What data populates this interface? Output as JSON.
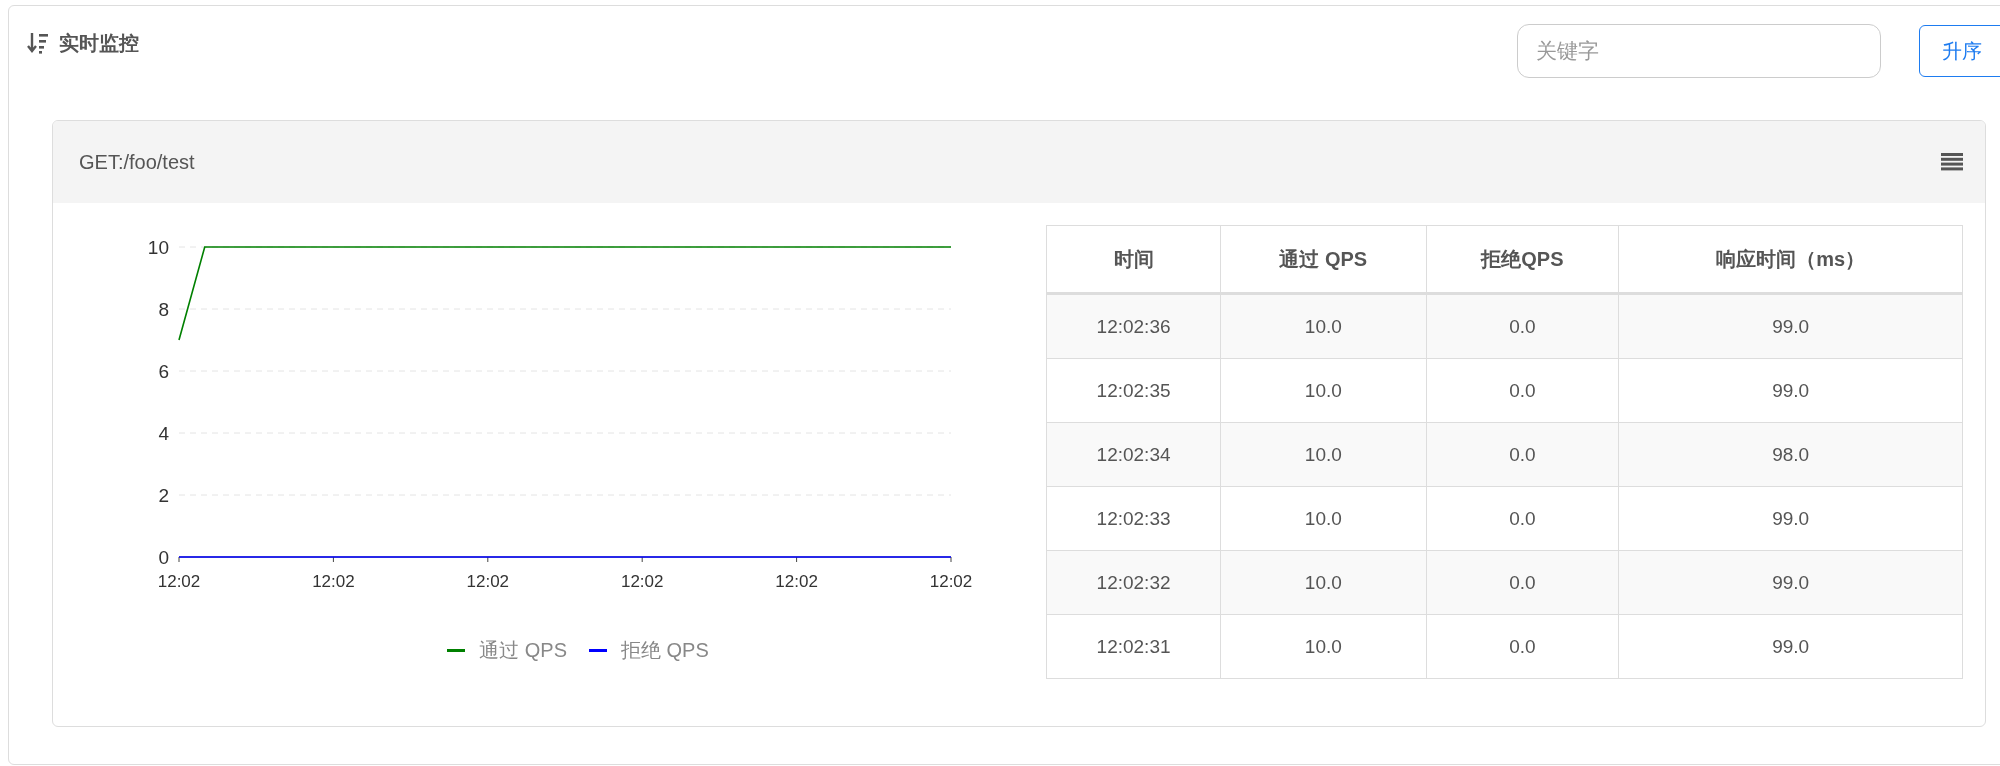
{
  "panel": {
    "title": "实时监控",
    "search": {
      "placeholder": "关键字"
    },
    "sort_button": "升序"
  },
  "card": {
    "title": "GET:/foo/test",
    "chart_data": {
      "type": "line",
      "categories": [
        "12:02",
        null,
        null,
        null,
        null,
        null,
        "12:02",
        null,
        null,
        null,
        null,
        null,
        "12:02",
        null,
        null,
        null,
        null,
        null,
        "12:02",
        null,
        null,
        null,
        null,
        null,
        "12:02",
        null,
        null,
        null,
        null,
        null,
        "12:02"
      ],
      "grid": true,
      "ylim": [
        0,
        10
      ],
      "yticks": [
        0,
        2,
        4,
        6,
        8,
        10
      ],
      "series": [
        {
          "name": "通过 QPS",
          "color": "#008000",
          "values": [
            7,
            10,
            10,
            10,
            10,
            10,
            10,
            10,
            10,
            10,
            10,
            10,
            10,
            10,
            10,
            10,
            10,
            10,
            10,
            10,
            10,
            10,
            10,
            10,
            10,
            10,
            10,
            10,
            10,
            10,
            10
          ]
        },
        {
          "name": "拒绝 QPS",
          "color": "#0000ff",
          "values": [
            0,
            0,
            0,
            0,
            0,
            0,
            0,
            0,
            0,
            0,
            0,
            0,
            0,
            0,
            0,
            0,
            0,
            0,
            0,
            0,
            0,
            0,
            0,
            0,
            0,
            0,
            0,
            0,
            0,
            0,
            0
          ]
        }
      ]
    },
    "table": {
      "columns": [
        "时间",
        "通过 QPS",
        "拒绝QPS",
        "响应时间（ms）"
      ],
      "rows": [
        [
          "12:02:36",
          "10.0",
          "0.0",
          "99.0"
        ],
        [
          "12:02:35",
          "10.0",
          "0.0",
          "99.0"
        ],
        [
          "12:02:34",
          "10.0",
          "0.0",
          "98.0"
        ],
        [
          "12:02:33",
          "10.0",
          "0.0",
          "99.0"
        ],
        [
          "12:02:32",
          "10.0",
          "0.0",
          "99.0"
        ],
        [
          "12:02:31",
          "10.0",
          "0.0",
          "99.0"
        ]
      ]
    }
  }
}
